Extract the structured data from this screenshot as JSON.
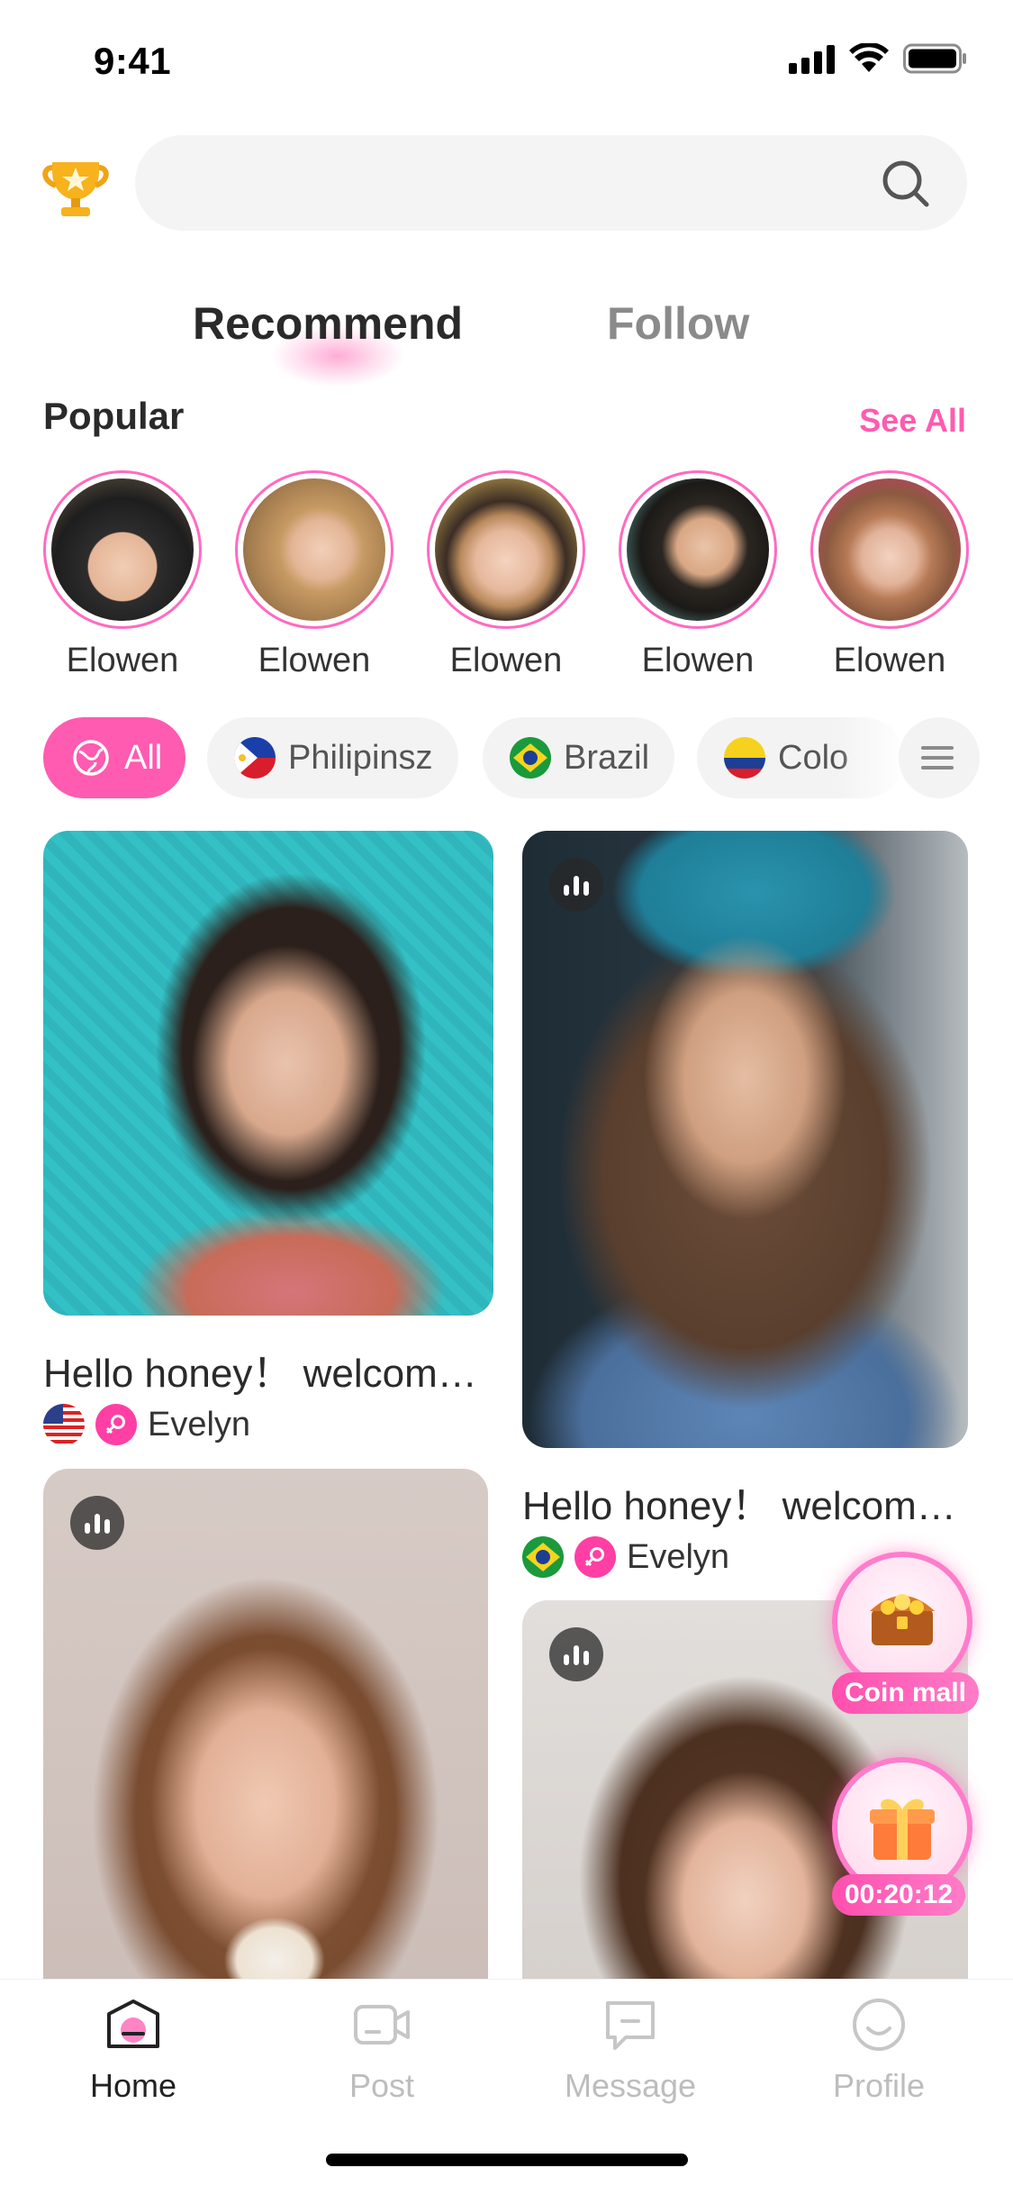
{
  "status_bar": {
    "time": "9:41"
  },
  "search": {
    "placeholder": ""
  },
  "tabs": [
    {
      "label": "Recommend",
      "active": true
    },
    {
      "label": "Follow",
      "active": false
    }
  ],
  "popular": {
    "title": "Popular",
    "see_all": "See All",
    "users": [
      {
        "name": "Elowen"
      },
      {
        "name": "Elowen"
      },
      {
        "name": "Elowen"
      },
      {
        "name": "Elowen"
      },
      {
        "name": "Elowen"
      }
    ]
  },
  "filters": [
    {
      "label": "All",
      "icon": "globe-icon",
      "selected": true
    },
    {
      "label": "Philipinsz",
      "icon": "philippines-flag-icon",
      "selected": false
    },
    {
      "label": "Brazil",
      "icon": "brazil-flag-icon",
      "selected": false
    },
    {
      "label": "Colo",
      "icon": "colombia-flag-icon",
      "selected": false
    }
  ],
  "feed": [
    {
      "title": "Hello honey！ welcom…",
      "user": "Evelyn",
      "flag": "usa-flag-icon"
    },
    {
      "title": "Hello honey！ welcom…",
      "user": "Evelyn",
      "flag": "brazil-flag-icon"
    }
  ],
  "floating": {
    "coin_mall": "Coin mall",
    "timer": "00:20:12"
  },
  "tabbar": [
    {
      "label": "Home",
      "active": true
    },
    {
      "label": "Post",
      "active": false
    },
    {
      "label": "Message",
      "active": false
    },
    {
      "label": "Profile",
      "active": false
    }
  ],
  "colors": {
    "accent": "#ff5bb0",
    "text": "#2a2a2a",
    "muted": "#8a8a8a"
  }
}
